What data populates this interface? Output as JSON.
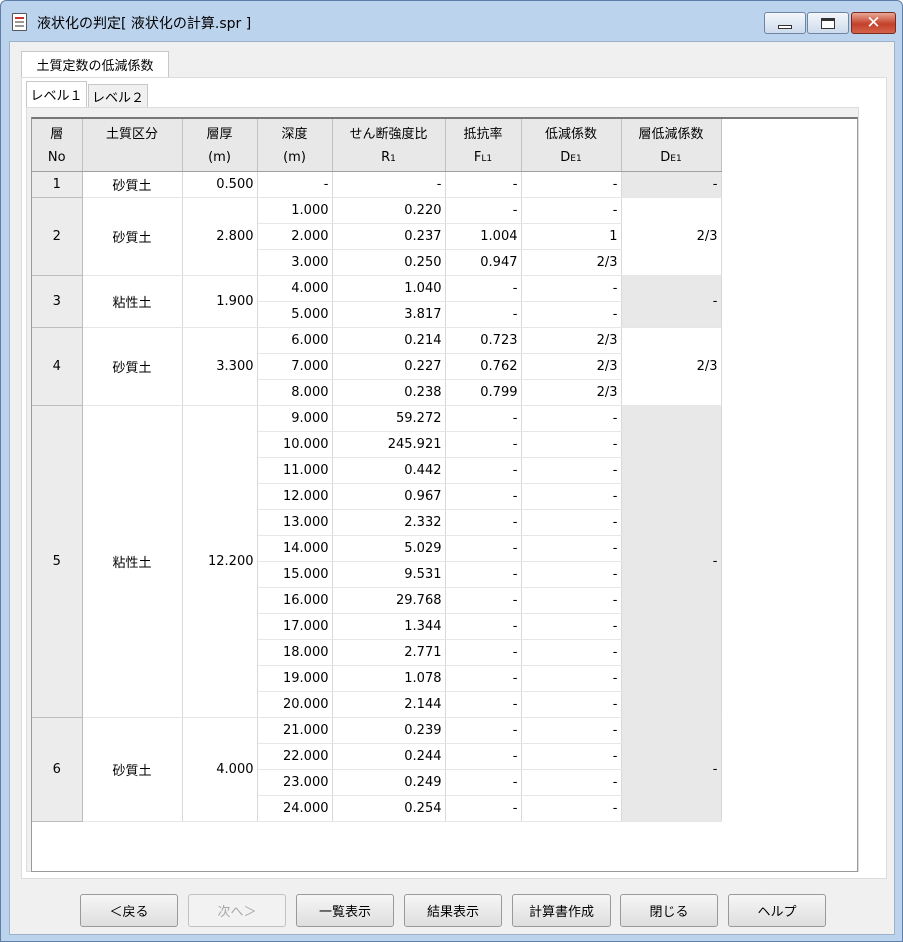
{
  "window": {
    "title": "液状化の判定[ 液状化の計算.spr ]"
  },
  "tabs": {
    "outer": "土質定数の低減係数",
    "inner": [
      "レベル１",
      "レベル２"
    ]
  },
  "table": {
    "headers": {
      "no": [
        "層",
        "No"
      ],
      "soil": [
        "土質区分",
        ""
      ],
      "thick": [
        "層厚",
        "(m)"
      ],
      "depth": [
        "深度",
        "(m)"
      ],
      "r": [
        "せん断強度比",
        "R",
        "1"
      ],
      "fl": [
        "抵抗率",
        "F",
        "L1"
      ],
      "de": [
        "低減係数",
        "D",
        "E1"
      ],
      "lde": [
        "層低減係数",
        "D",
        "E1"
      ]
    },
    "layers": [
      {
        "no": "1",
        "soil": "砂質土",
        "thickness": "0.500",
        "layer_de": "-",
        "layer_de_shaded": true,
        "rows": [
          {
            "depth": "-",
            "r": "-",
            "fl": "-",
            "de": "-"
          }
        ]
      },
      {
        "no": "2",
        "soil": "砂質土",
        "thickness": "2.800",
        "layer_de": "2/3",
        "layer_de_shaded": false,
        "rows": [
          {
            "depth": "1.000",
            "r": "0.220",
            "fl": "-",
            "de": "-"
          },
          {
            "depth": "2.000",
            "r": "0.237",
            "fl": "1.004",
            "de": "1"
          },
          {
            "depth": "3.000",
            "r": "0.250",
            "fl": "0.947",
            "de": "2/3"
          }
        ]
      },
      {
        "no": "3",
        "soil": "粘性土",
        "thickness": "1.900",
        "layer_de": "-",
        "layer_de_shaded": true,
        "rows": [
          {
            "depth": "4.000",
            "r": "1.040",
            "fl": "-",
            "de": "-"
          },
          {
            "depth": "5.000",
            "r": "3.817",
            "fl": "-",
            "de": "-"
          }
        ]
      },
      {
        "no": "4",
        "soil": "砂質土",
        "thickness": "3.300",
        "layer_de": "2/3",
        "layer_de_shaded": false,
        "rows": [
          {
            "depth": "6.000",
            "r": "0.214",
            "fl": "0.723",
            "de": "2/3"
          },
          {
            "depth": "7.000",
            "r": "0.227",
            "fl": "0.762",
            "de": "2/3"
          },
          {
            "depth": "8.000",
            "r": "0.238",
            "fl": "0.799",
            "de": "2/3"
          }
        ]
      },
      {
        "no": "5",
        "soil": "粘性土",
        "thickness": "12.200",
        "layer_de": "-",
        "layer_de_shaded": true,
        "rows": [
          {
            "depth": "9.000",
            "r": "59.272",
            "fl": "-",
            "de": "-"
          },
          {
            "depth": "10.000",
            "r": "245.921",
            "fl": "-",
            "de": "-"
          },
          {
            "depth": "11.000",
            "r": "0.442",
            "fl": "-",
            "de": "-"
          },
          {
            "depth": "12.000",
            "r": "0.967",
            "fl": "-",
            "de": "-"
          },
          {
            "depth": "13.000",
            "r": "2.332",
            "fl": "-",
            "de": "-"
          },
          {
            "depth": "14.000",
            "r": "5.029",
            "fl": "-",
            "de": "-"
          },
          {
            "depth": "15.000",
            "r": "9.531",
            "fl": "-",
            "de": "-"
          },
          {
            "depth": "16.000",
            "r": "29.768",
            "fl": "-",
            "de": "-"
          },
          {
            "depth": "17.000",
            "r": "1.344",
            "fl": "-",
            "de": "-"
          },
          {
            "depth": "18.000",
            "r": "2.771",
            "fl": "-",
            "de": "-"
          },
          {
            "depth": "19.000",
            "r": "1.078",
            "fl": "-",
            "de": "-"
          },
          {
            "depth": "20.000",
            "r": "2.144",
            "fl": "-",
            "de": "-"
          }
        ]
      },
      {
        "no": "6",
        "soil": "砂質土",
        "thickness": "4.000",
        "layer_de": "-",
        "layer_de_shaded": true,
        "rows": [
          {
            "depth": "21.000",
            "r": "0.239",
            "fl": "-",
            "de": "-"
          },
          {
            "depth": "22.000",
            "r": "0.244",
            "fl": "-",
            "de": "-"
          },
          {
            "depth": "23.000",
            "r": "0.249",
            "fl": "-",
            "de": "-"
          },
          {
            "depth": "24.000",
            "r": "0.254",
            "fl": "-",
            "de": "-"
          }
        ]
      }
    ]
  },
  "buttons": [
    {
      "name": "back-button",
      "label": "＜戻る",
      "enabled": true
    },
    {
      "name": "next-button",
      "label": "次へ＞",
      "enabled": false
    },
    {
      "name": "list-view-button",
      "label": "一覧表示",
      "enabled": true
    },
    {
      "name": "result-view-button",
      "label": "結果表示",
      "enabled": true
    },
    {
      "name": "create-report-button",
      "label": "計算書作成",
      "enabled": true
    },
    {
      "name": "close-button",
      "label": "閉じる",
      "enabled": true
    },
    {
      "name": "help-button",
      "label": "ヘルプ",
      "enabled": true
    }
  ]
}
